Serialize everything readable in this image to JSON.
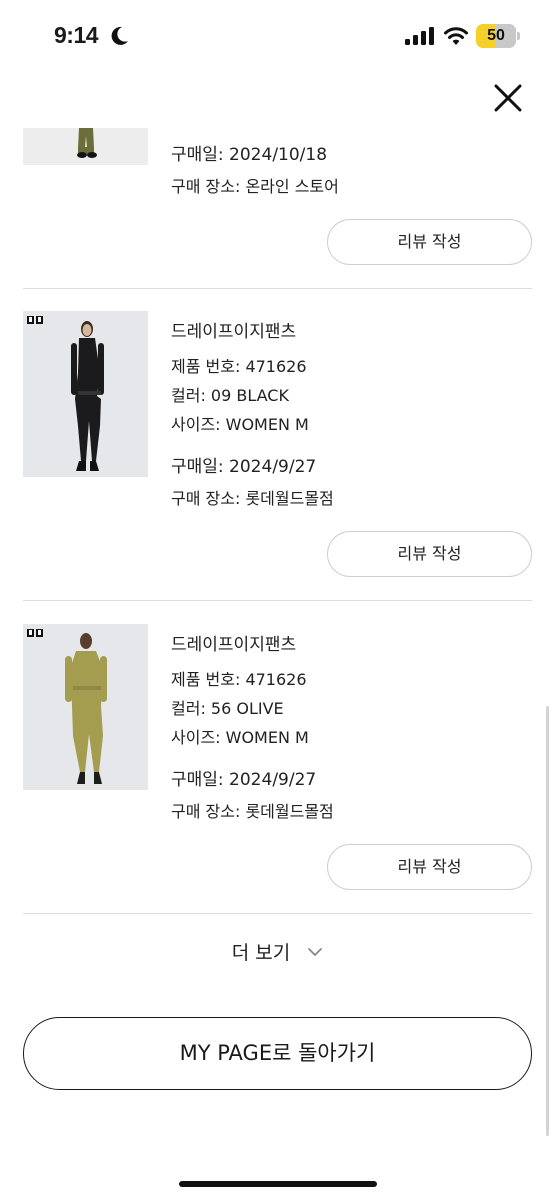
{
  "status_bar": {
    "time": "9:14",
    "battery": "50",
    "battery_level": 0.5
  },
  "orders": [
    {
      "purchase_date_label": "구매일: 2024/10/18",
      "store_label": "구매 장소: 온라인 스토어",
      "review_label": "리뷰 작성"
    },
    {
      "name": "드레이프이지팬츠",
      "product_no": "제품 번호: 471626",
      "color": "컬러: 09 BLACK",
      "size": "사이즈: WOMEN M",
      "purchase_date_label": "구매일: 2024/9/27",
      "store_label": "구매 장소: 롯데월드몰점",
      "review_label": "리뷰 작성"
    },
    {
      "name": "드레이프이지팬츠",
      "product_no": "제품 번호: 471626",
      "color": "컬러: 56 OLIVE",
      "size": "사이즈: WOMEN M",
      "purchase_date_label": "구매일: 2024/9/27",
      "store_label": "구매 장소: 롯데월드몰점",
      "review_label": "리뷰 작성"
    }
  ],
  "more_label": "더 보기",
  "mypage_label": "MY PAGE로 돌아가기",
  "colors": {
    "olive": "#6b6d3a",
    "black_outfit": "#1b1b1d",
    "olive_outfit": "#a49c4f",
    "badge_yellow": "#f5d02a"
  }
}
